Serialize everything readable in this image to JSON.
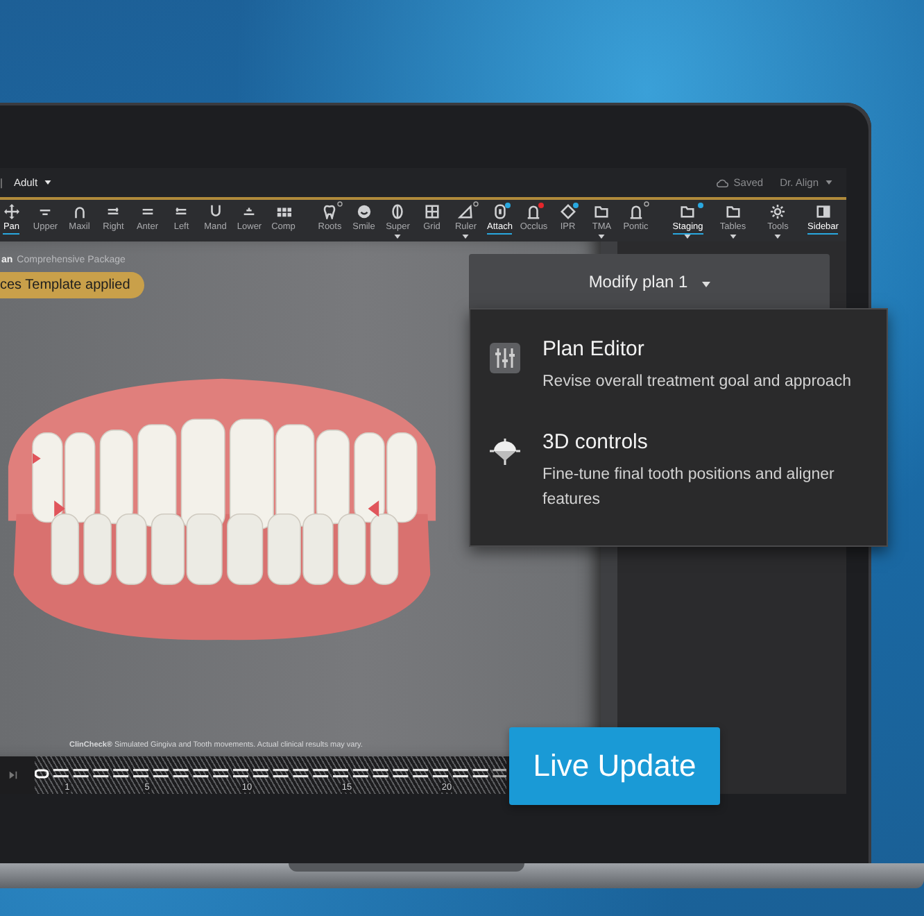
{
  "top_bar": {
    "separator": "|",
    "patient_type": "Adult",
    "save_status": "Saved",
    "user": "Dr. Align"
  },
  "toolbar": {
    "groups": [
      [
        {
          "label": "Pan",
          "selected": true,
          "has_menu": false,
          "ring": false,
          "dot": false
        },
        {
          "label": "Upper",
          "selected": false,
          "has_menu": false,
          "ring": false,
          "dot": false
        },
        {
          "label": "Maxil",
          "selected": false,
          "has_menu": false,
          "ring": false,
          "dot": false
        },
        {
          "label": "Right",
          "selected": false,
          "has_menu": false,
          "ring": false,
          "dot": false
        },
        {
          "label": "Anter",
          "selected": false,
          "has_menu": false,
          "ring": false,
          "dot": false
        },
        {
          "label": "Left",
          "selected": false,
          "has_menu": false,
          "ring": false,
          "dot": false
        },
        {
          "label": "Mand",
          "selected": false,
          "has_menu": false,
          "ring": false,
          "dot": false
        },
        {
          "label": "Lower",
          "selected": false,
          "has_menu": false,
          "ring": false,
          "dot": false
        },
        {
          "label": "Comp",
          "selected": false,
          "has_menu": false,
          "ring": false,
          "dot": false
        }
      ],
      [
        {
          "label": "Roots",
          "selected": false,
          "has_menu": false,
          "ring": true,
          "dot": false
        },
        {
          "label": "Smile",
          "selected": false,
          "has_menu": false,
          "ring": false,
          "dot": false
        },
        {
          "label": "Super",
          "selected": false,
          "has_menu": true,
          "ring": false,
          "dot": false
        },
        {
          "label": "Grid",
          "selected": false,
          "has_menu": false,
          "ring": false,
          "dot": false
        },
        {
          "label": "Ruler",
          "selected": false,
          "has_menu": true,
          "ring": true,
          "dot": false
        },
        {
          "label": "Attach",
          "selected": true,
          "has_menu": false,
          "ring": false,
          "dot": true,
          "color": "#29a8e0"
        },
        {
          "label": "Occlus",
          "selected": false,
          "has_menu": false,
          "ring": false,
          "dot": true,
          "color": "#e3262b"
        },
        {
          "label": "IPR",
          "selected": false,
          "has_menu": false,
          "ring": false,
          "dot": true,
          "color": "#29a8e0"
        },
        {
          "label": "TMA",
          "selected": false,
          "has_menu": true,
          "ring": false,
          "dot": false
        },
        {
          "label": "Pontic",
          "selected": false,
          "has_menu": false,
          "ring": true,
          "dot": false
        }
      ],
      [
        {
          "label": "Staging",
          "selected": true,
          "has_menu": true,
          "ring": false,
          "dot": true,
          "color": "#29a8e0"
        },
        {
          "label": "Tables",
          "selected": false,
          "has_menu": true,
          "ring": false,
          "dot": false
        },
        {
          "label": "Tools",
          "selected": false,
          "has_menu": true,
          "ring": false,
          "dot": false
        },
        {
          "label": "Sidebar",
          "selected": true,
          "has_menu": false,
          "ring": false,
          "dot": false
        }
      ]
    ]
  },
  "viewport": {
    "plan_name": "an",
    "package": "Comprehensive Package",
    "template_badge": "ces Template applied",
    "disclaimer": "**ClinCheck®** Simulated Gingiva and Tooth movements. Actual clinical results may vary."
  },
  "timeline": {
    "ticks": [
      "1",
      "5",
      "10",
      "15",
      "20"
    ]
  },
  "plan_dropdown": {
    "label": "Modify plan 1",
    "expanded": true,
    "options": [
      {
        "title": "Plan Editor",
        "description": "Revise overall treatment goal and approach"
      },
      {
        "title": "3D controls",
        "description": "Fine-tune final tooth positions and aligner features"
      }
    ]
  },
  "live_update_button": "Live Update"
}
